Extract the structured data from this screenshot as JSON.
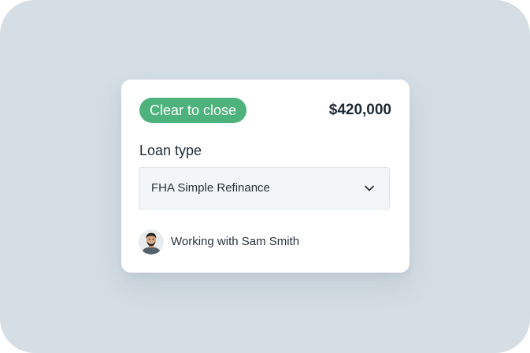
{
  "card": {
    "status_badge": "Clear to close",
    "amount": "$420,000",
    "loan_type": {
      "label": "Loan type",
      "selected_value": "FHA Simple Refinance"
    },
    "collaborator": {
      "text": "Working with Sam Smith"
    }
  },
  "colors": {
    "background": "#d5dee5",
    "card": "#ffffff",
    "status_badge": "#4db27c",
    "select_background": "#f3f6f8",
    "text": "#1f2933"
  },
  "icons": {
    "select_indicator": "chevron-down-icon",
    "avatar": "avatar"
  }
}
